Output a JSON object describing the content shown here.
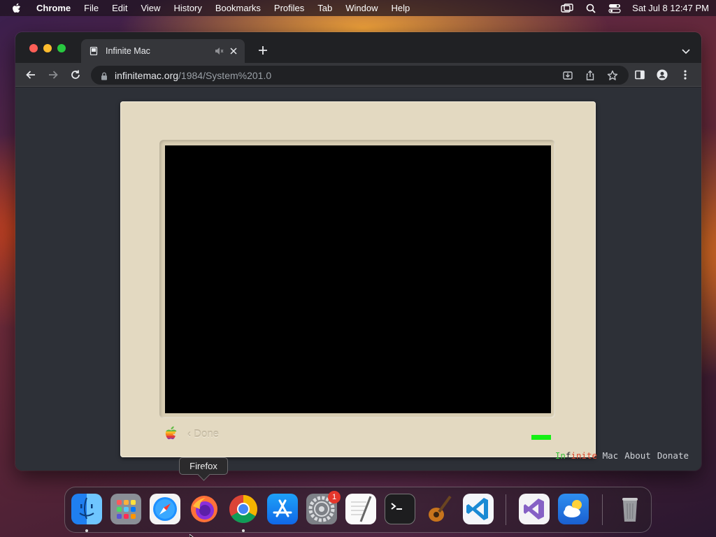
{
  "menubar": {
    "app": "Chrome",
    "items": [
      "File",
      "Edit",
      "View",
      "History",
      "Bookmarks",
      "Profiles",
      "Tab",
      "Window",
      "Help"
    ],
    "clock": "Sat Jul 8  12:47 PM"
  },
  "browser": {
    "tab_title": "Infinite Mac",
    "url_host": "infinitemac.org",
    "url_path": "/1984/System%201.0"
  },
  "emulator": {
    "done_label": "‹ Done",
    "footer": {
      "brand_in": "In",
      "brand_f": "f",
      "brand_inite": "inite",
      "brand_mac": "Mac",
      "about": "About",
      "donate": "Donate"
    }
  },
  "dock": {
    "tooltip": "Firefox",
    "settings_badge": "1"
  },
  "colors": {
    "accent_green": "#14f014",
    "bezel": "#e3d9c1",
    "badge": "#e5372c"
  }
}
